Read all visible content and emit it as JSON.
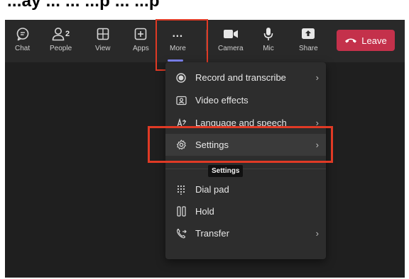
{
  "top_caption": "...ay ... ... ...p ... ...p",
  "toolbar": {
    "chat_label": "Chat",
    "people_label": "People",
    "people_count": "2",
    "view_label": "View",
    "apps_label": "Apps",
    "more_icon": "…",
    "more_label": "More",
    "camera_label": "Camera",
    "mic_label": "Mic",
    "share_label": "Share",
    "leave_label": "Leave"
  },
  "menu": {
    "items": [
      {
        "label": "Record and transcribe",
        "icon": "record-icon",
        "has_submenu": true
      },
      {
        "label": "Video effects",
        "icon": "video-effects-icon",
        "has_submenu": false
      },
      {
        "label": "Language and speech",
        "icon": "language-icon",
        "has_submenu": true
      },
      {
        "label": "Settings",
        "icon": "gear-icon",
        "has_submenu": true
      },
      {
        "label": "Dial pad",
        "icon": "dialpad-icon",
        "has_submenu": false
      },
      {
        "label": "Hold",
        "icon": "hold-icon",
        "has_submenu": false
      },
      {
        "label": "Transfer",
        "icon": "transfer-icon",
        "has_submenu": true
      }
    ],
    "chevron": "›"
  },
  "tooltip": "Settings",
  "colors": {
    "toolbar_bg": "#292929",
    "app_bg": "#1f1f1f",
    "menu_bg": "#2d2d2d",
    "leave_red": "#c4314b",
    "highlight_red": "#e03a25",
    "accent": "#7f85f5"
  }
}
